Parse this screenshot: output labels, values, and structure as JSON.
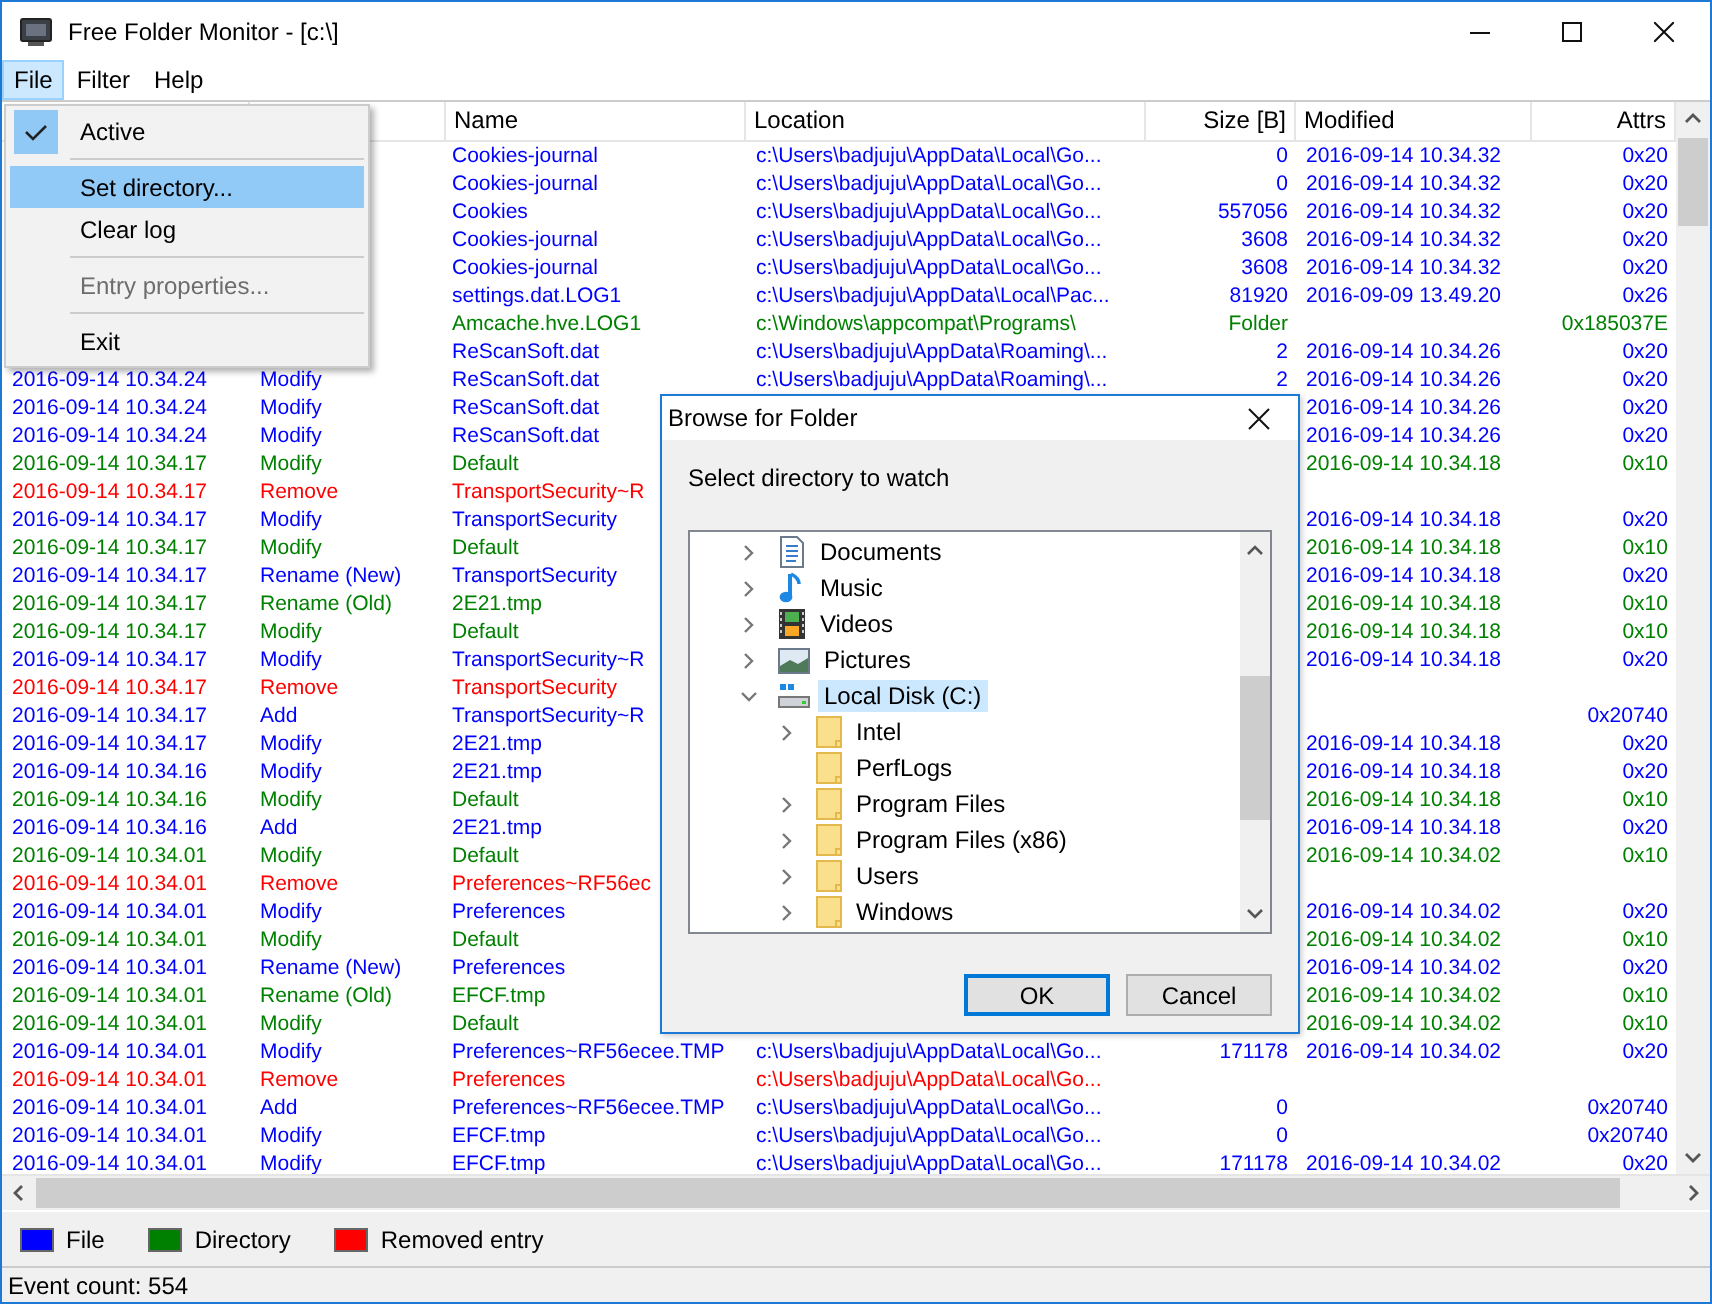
{
  "window": {
    "title": "Free Folder Monitor - [c:\\]"
  },
  "menubar": [
    {
      "label": "File",
      "selected": true
    },
    {
      "label": "Filter",
      "selected": false
    },
    {
      "label": "Help",
      "selected": false
    }
  ],
  "file_menu": {
    "items": [
      {
        "kind": "item",
        "label": "Active",
        "checked": true,
        "selected": false,
        "disabled": false
      },
      {
        "kind": "separator"
      },
      {
        "kind": "item",
        "label": "Set directory...",
        "checked": false,
        "selected": true,
        "disabled": false
      },
      {
        "kind": "item",
        "label": "Clear log",
        "checked": false,
        "selected": false,
        "disabled": false
      },
      {
        "kind": "separator"
      },
      {
        "kind": "item",
        "label": "Entry properties...",
        "checked": false,
        "selected": false,
        "disabled": true
      },
      {
        "kind": "separator"
      },
      {
        "kind": "item",
        "label": "Exit",
        "checked": false,
        "selected": false,
        "disabled": false
      }
    ]
  },
  "table": {
    "columns": [
      "Name",
      "Location",
      "Size [B]",
      "Modified",
      "Attrs"
    ],
    "rows": [
      {
        "kind": "file",
        "name": "Cookies-journal",
        "location": "c:\\Users\\badjuju\\AppData\\Local\\Go...",
        "size": "0",
        "modified": "2016-09-14 10.34.32",
        "attrs": "0x20"
      },
      {
        "kind": "file",
        "name": "Cookies-journal",
        "location": "c:\\Users\\badjuju\\AppData\\Local\\Go...",
        "size": "0",
        "modified": "2016-09-14 10.34.32",
        "attrs": "0x20"
      },
      {
        "kind": "file",
        "name": "Cookies",
        "location": "c:\\Users\\badjuju\\AppData\\Local\\Go...",
        "size": "557056",
        "modified": "2016-09-14 10.34.32",
        "attrs": "0x20"
      },
      {
        "kind": "file",
        "name": "Cookies-journal",
        "location": "c:\\Users\\badjuju\\AppData\\Local\\Go...",
        "size": "3608",
        "modified": "2016-09-14 10.34.32",
        "attrs": "0x20"
      },
      {
        "kind": "file",
        "name": "Cookies-journal",
        "location": "c:\\Users\\badjuju\\AppData\\Local\\Go...",
        "size": "3608",
        "modified": "2016-09-14 10.34.32",
        "attrs": "0x20"
      },
      {
        "kind": "file",
        "name": "settings.dat.LOG1",
        "location": "c:\\Users\\badjuju\\AppData\\Local\\Pac...",
        "size": "81920",
        "modified": "2016-09-09 13.49.20",
        "attrs": "0x26"
      },
      {
        "kind": "directory",
        "name": "Amcache.hve.LOG1",
        "location": "c:\\Windows\\appcompat\\Programs\\",
        "size": "Folder",
        "attrs": "0x185037E"
      },
      {
        "kind": "file",
        "name": "ReScanSoft.dat",
        "location": "c:\\Users\\badjuju\\AppData\\Roaming\\...",
        "size": "2",
        "modified": "2016-09-14 10.34.26",
        "attrs": "0x20"
      },
      {
        "kind": "file",
        "date": "2016-09-14 10.34.24",
        "action": "Modify",
        "name": "ReScanSoft.dat",
        "location": "c:\\Users\\badjuju\\AppData\\Roaming\\...",
        "size": "2",
        "modified": "2016-09-14 10.34.26",
        "attrs": "0x20"
      },
      {
        "kind": "file",
        "date": "2016-09-14 10.34.24",
        "action": "Modify",
        "name": "ReScanSoft.dat",
        "modified": "2016-09-14 10.34.26",
        "attrs": "0x20"
      },
      {
        "kind": "file",
        "date": "2016-09-14 10.34.24",
        "action": "Modify",
        "name": "ReScanSoft.dat",
        "modified": "2016-09-14 10.34.26",
        "attrs": "0x20"
      },
      {
        "kind": "directory",
        "date": "2016-09-14 10.34.17",
        "action": "Modify",
        "name": "Default",
        "modified": "2016-09-14 10.34.18",
        "attrs": "0x10"
      },
      {
        "kind": "removed",
        "date": "2016-09-14 10.34.17",
        "action": "Remove",
        "name": "TransportSecurity~R"
      },
      {
        "kind": "file",
        "date": "2016-09-14 10.34.17",
        "action": "Modify",
        "name": "TransportSecurity",
        "modified": "2016-09-14 10.34.18",
        "attrs": "0x20"
      },
      {
        "kind": "directory",
        "date": "2016-09-14 10.34.17",
        "action": "Modify",
        "name": "Default",
        "modified": "2016-09-14 10.34.18",
        "attrs": "0x10"
      },
      {
        "kind": "file",
        "date": "2016-09-14 10.34.17",
        "action": "Rename (New)",
        "name": "TransportSecurity",
        "modified": "2016-09-14 10.34.18",
        "attrs": "0x20"
      },
      {
        "kind": "directory",
        "date": "2016-09-14 10.34.17",
        "action": "Rename (Old)",
        "name": "2E21.tmp",
        "modified": "2016-09-14 10.34.18",
        "attrs": "0x10"
      },
      {
        "kind": "directory",
        "date": "2016-09-14 10.34.17",
        "action": "Modify",
        "name": "Default",
        "modified": "2016-09-14 10.34.18",
        "attrs": "0x10"
      },
      {
        "kind": "file",
        "date": "2016-09-14 10.34.17",
        "action": "Modify",
        "name": "TransportSecurity~R",
        "modified": "2016-09-14 10.34.18",
        "attrs": "0x20"
      },
      {
        "kind": "removed",
        "date": "2016-09-14 10.34.17",
        "action": "Remove",
        "name": "TransportSecurity"
      },
      {
        "kind": "file",
        "date": "2016-09-14 10.34.17",
        "action": "Add",
        "name": "TransportSecurity~R",
        "attrs": "0x20740"
      },
      {
        "kind": "file",
        "date": "2016-09-14 10.34.17",
        "action": "Modify",
        "name": "2E21.tmp",
        "modified": "2016-09-14 10.34.18",
        "attrs": "0x20"
      },
      {
        "kind": "file",
        "date": "2016-09-14 10.34.16",
        "action": "Modify",
        "name": "2E21.tmp",
        "modified": "2016-09-14 10.34.18",
        "attrs": "0x20"
      },
      {
        "kind": "directory",
        "date": "2016-09-14 10.34.16",
        "action": "Modify",
        "name": "Default",
        "modified": "2016-09-14 10.34.18",
        "attrs": "0x10"
      },
      {
        "kind": "file",
        "date": "2016-09-14 10.34.16",
        "action": "Add",
        "name": "2E21.tmp",
        "modified": "2016-09-14 10.34.18",
        "attrs": "0x20"
      },
      {
        "kind": "directory",
        "date": "2016-09-14 10.34.01",
        "action": "Modify",
        "name": "Default",
        "modified": "2016-09-14 10.34.02",
        "attrs": "0x10"
      },
      {
        "kind": "removed",
        "date": "2016-09-14 10.34.01",
        "action": "Remove",
        "name": "Preferences~RF56ec"
      },
      {
        "kind": "file",
        "date": "2016-09-14 10.34.01",
        "action": "Modify",
        "name": "Preferences",
        "modified": "2016-09-14 10.34.02",
        "attrs": "0x20"
      },
      {
        "kind": "directory",
        "date": "2016-09-14 10.34.01",
        "action": "Modify",
        "name": "Default",
        "modified": "2016-09-14 10.34.02",
        "attrs": "0x10"
      },
      {
        "kind": "file",
        "date": "2016-09-14 10.34.01",
        "action": "Rename (New)",
        "name": "Preferences",
        "modified": "2016-09-14 10.34.02",
        "attrs": "0x20"
      },
      {
        "kind": "directory",
        "date": "2016-09-14 10.34.01",
        "action": "Rename (Old)",
        "name": "EFCF.tmp",
        "modified": "2016-09-14 10.34.02",
        "attrs": "0x10"
      },
      {
        "kind": "directory",
        "date": "2016-09-14 10.34.01",
        "action": "Modify",
        "name": "Default",
        "modified": "2016-09-14 10.34.02",
        "attrs": "0x10"
      },
      {
        "kind": "file",
        "date": "2016-09-14 10.34.01",
        "action": "Modify",
        "name": "Preferences~RF56ecee.TMP",
        "location": "c:\\Users\\badjuju\\AppData\\Local\\Go...",
        "size": "171178",
        "modified": "2016-09-14 10.34.02",
        "attrs": "0x20"
      },
      {
        "kind": "removed",
        "date": "2016-09-14 10.34.01",
        "action": "Remove",
        "name": "Preferences",
        "location": "c:\\Users\\badjuju\\AppData\\Local\\Go..."
      },
      {
        "kind": "file",
        "date": "2016-09-14 10.34.01",
        "action": "Add",
        "name": "Preferences~RF56ecee.TMP",
        "location": "c:\\Users\\badjuju\\AppData\\Local\\Go...",
        "size": "0",
        "attrs": "0x20740"
      },
      {
        "kind": "file",
        "date": "2016-09-14 10.34.01",
        "action": "Modify",
        "name": "EFCF.tmp",
        "location": "c:\\Users\\badjuju\\AppData\\Local\\Go...",
        "size": "0",
        "attrs": "0x20740"
      },
      {
        "kind": "file",
        "date": "2016-09-14 10.34.01",
        "action": "Modify",
        "name": "EFCF.tmp",
        "location": "c:\\Users\\badjuju\\AppData\\Local\\Go...",
        "size": "171178",
        "modified": "2016-09-14 10.34.02",
        "attrs": "0x20"
      }
    ]
  },
  "legend": [
    {
      "label": "File",
      "color": "#0000ff"
    },
    {
      "label": "Directory",
      "color": "#008000"
    },
    {
      "label": "Removed entry",
      "color": "#ff0000"
    }
  ],
  "status_bar": "Event count: 554",
  "dialog": {
    "title": "Browse for Folder",
    "prompt": "Select directory to watch",
    "tree": [
      {
        "label": "Documents",
        "kind": "documents",
        "expanded": false,
        "selected": false
      },
      {
        "label": "Music",
        "kind": "music",
        "expanded": false,
        "selected": false
      },
      {
        "label": "Videos",
        "kind": "videos",
        "expanded": false,
        "selected": false
      },
      {
        "label": "Pictures",
        "kind": "pictures",
        "expanded": false,
        "selected": false
      },
      {
        "label": "Local Disk (C:)",
        "kind": "drive",
        "expanded": true,
        "selected": true,
        "children": [
          {
            "label": "Intel",
            "kind": "folder",
            "expanded": false,
            "selected": false
          },
          {
            "label": "PerfLogs",
            "kind": "folder",
            "selected": false
          },
          {
            "label": "Program Files",
            "kind": "folder",
            "expanded": false,
            "selected": false
          },
          {
            "label": "Program Files (x86)",
            "kind": "folder",
            "expanded": false,
            "selected": false
          },
          {
            "label": "Users",
            "kind": "folder",
            "expanded": false,
            "selected": false
          },
          {
            "label": "Windows",
            "kind": "folder",
            "expanded": false,
            "selected": false
          }
        ]
      }
    ],
    "buttons": [
      {
        "label": "OK",
        "default": true
      },
      {
        "label": "Cancel",
        "default": false
      }
    ]
  }
}
